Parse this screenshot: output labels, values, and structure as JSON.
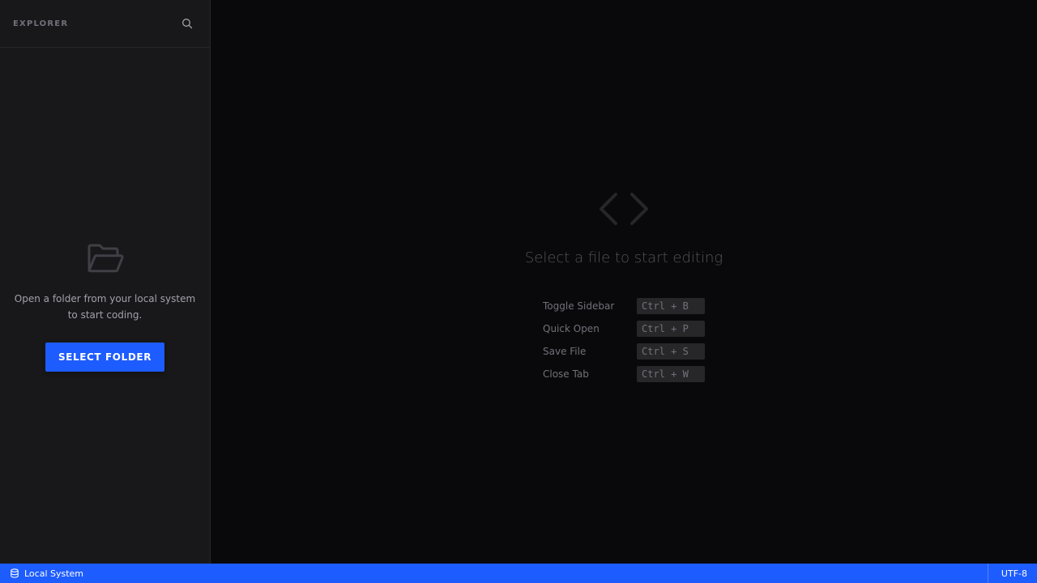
{
  "sidebar": {
    "title": "EXPLORER",
    "empty_state": {
      "line1": "Open a folder from your local system",
      "line2": "to start coding.",
      "button_label": "SELECT FOLDER"
    }
  },
  "editor": {
    "welcome_title": "Select a file to start editing",
    "shortcuts": [
      {
        "label": "Toggle Sidebar",
        "keys": "Ctrl + B"
      },
      {
        "label": "Quick Open",
        "keys": "Ctrl + P"
      },
      {
        "label": "Save File",
        "keys": "Ctrl + S"
      },
      {
        "label": "Close Tab",
        "keys": "Ctrl + W"
      }
    ]
  },
  "statusbar": {
    "location": "Local System",
    "encoding": "UTF-8"
  },
  "colors": {
    "accent": "#1d5cff",
    "sidebar_bg": "#18181b",
    "editor_bg": "#09090b"
  },
  "icons": [
    "search-icon",
    "folder-open-icon",
    "code-icon",
    "database-icon"
  ]
}
